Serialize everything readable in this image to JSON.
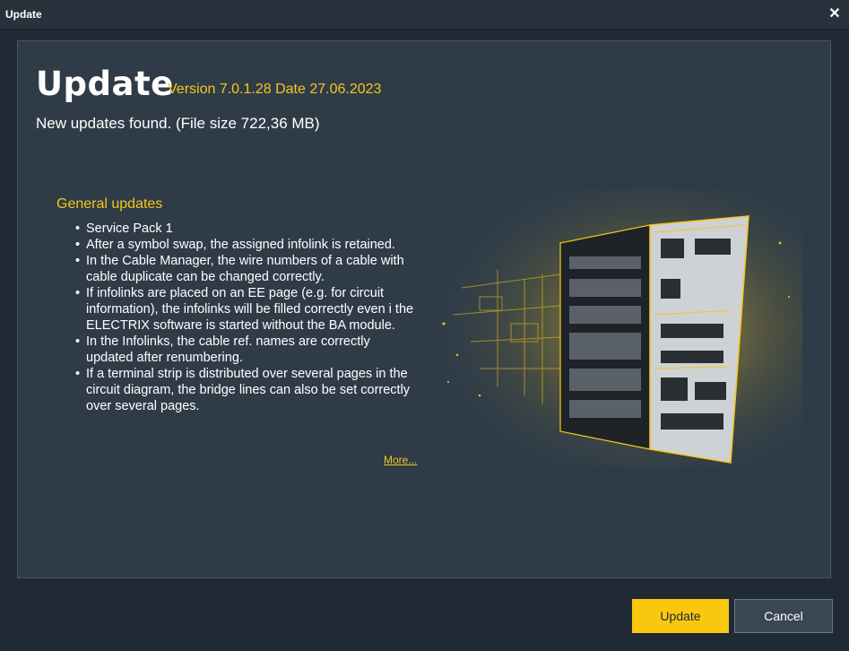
{
  "window": {
    "title": "Update"
  },
  "header": {
    "heading": "Update",
    "version": "Version 7.0.1.28 Date 27.06.2023",
    "found_text": "New updates found. (File size 722,36 MB)"
  },
  "updates": {
    "section_title": "General updates",
    "items": [
      "Service Pack 1",
      "After a symbol swap, the assigned infolink is retained.",
      "In the Cable Manager, the wire numbers of a cable with cable duplicate can be changed correctly.",
      "If infolinks are placed on an EE page (e.g. for circuit information), the infolinks will be filled correctly even i the ELECTRIX software is started without the BA module.",
      "In the Infolinks, the cable ref. names are correctly updated after renumbering.",
      "If a terminal strip is distributed over several pages in the circuit diagram, the bridge lines can also be set correctly over several pages."
    ],
    "more_link": "More..."
  },
  "buttons": {
    "update": "Update",
    "cancel": "Cancel"
  },
  "icons": {
    "close": "close-icon",
    "illustration": "control-cabinet-illustration"
  },
  "colors": {
    "accent": "#f6c619",
    "background": "#1f2a35",
    "panel": "#2f3c48"
  }
}
